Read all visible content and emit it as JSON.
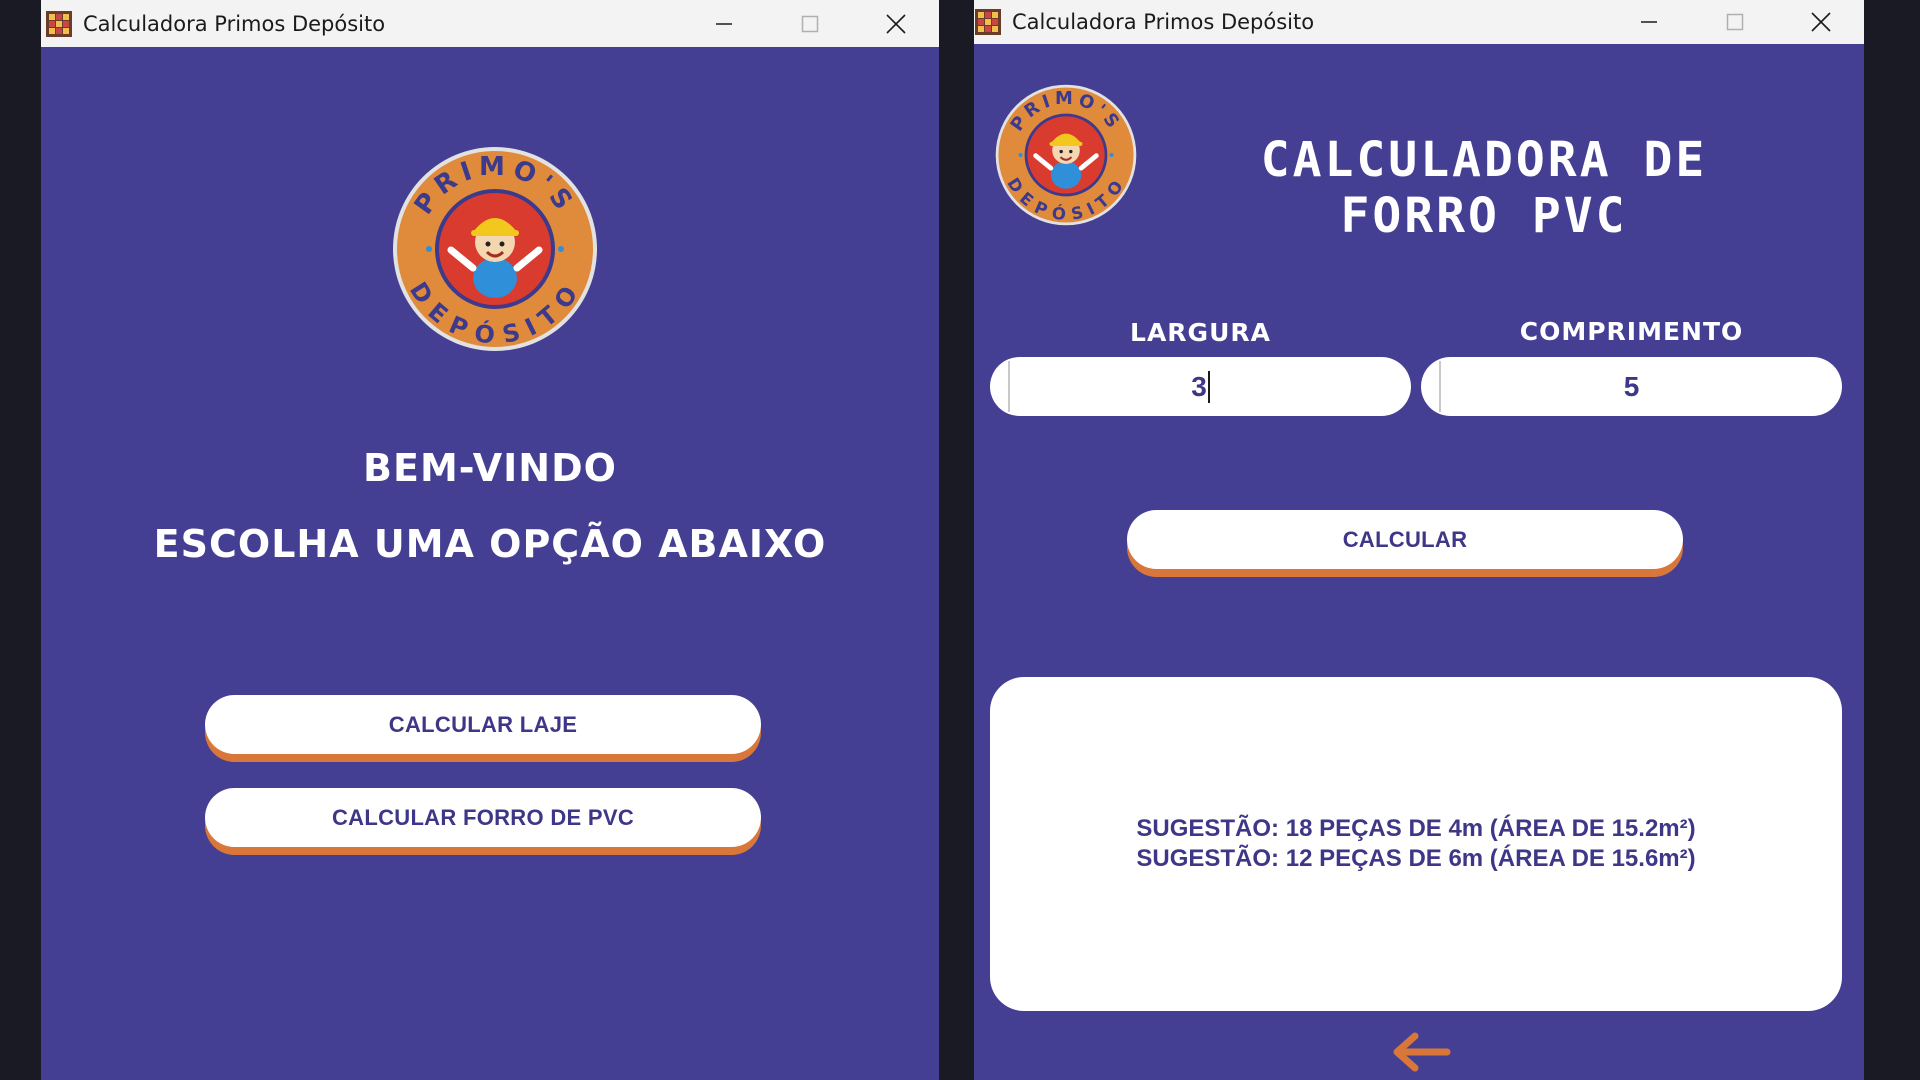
{
  "colors": {
    "window_bg": "#443f93",
    "accent_orange": "#d9773a",
    "button_text": "#3e3788",
    "titlebar_bg": "#f3f3f3",
    "desktop_bg": "#1a1a24"
  },
  "left_window": {
    "title": "Calculadora Primos Depósito",
    "logo_text_top": "PRIMO'S",
    "logo_text_bottom": "DEPÓSITO",
    "welcome": "BEM-VINDO",
    "subtitle": "ESCOLHA UMA OPÇÃO ABAIXO",
    "buttons": {
      "laje": "CALCULAR LAJE",
      "forro": "CALCULAR FORRO DE PVC"
    }
  },
  "right_window": {
    "title": "Calculadora Primos Depósito",
    "logo_text_top": "PRIMO'S",
    "logo_text_bottom": "DEPÓSITO",
    "heading_line1": "CALCULADORA DE",
    "heading_line2": "FORRO PVC",
    "largura": {
      "label": "LARGURA",
      "value": "3"
    },
    "comprimento": {
      "label": "COMPRIMENTO",
      "value": "5"
    },
    "calculate_label": "CALCULAR",
    "results": [
      "SUGESTÃO: 18 PEÇAS DE 4m (ÁREA DE 15.2m²)",
      "SUGESTÃO: 12 PEÇAS DE 6m (ÁREA DE 15.6m²)"
    ],
    "back_icon": "arrow-left-icon"
  },
  "icons": {
    "app": "app-grid-icon",
    "minimize": "minimize-icon",
    "maximize": "maximize-icon",
    "close": "close-icon"
  }
}
